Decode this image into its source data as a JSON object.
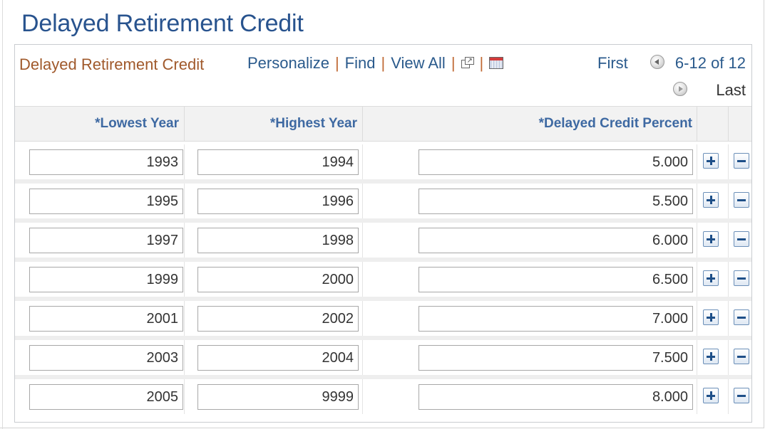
{
  "page": {
    "title": "Delayed Retirement Credit"
  },
  "grid": {
    "title": "Delayed Retirement Credit",
    "toolbar": {
      "personalize": "Personalize",
      "find": "Find",
      "view_all": "View All",
      "separator": "|",
      "zoom_icon": "new-window-icon",
      "download_icon": "spreadsheet-download-icon"
    },
    "pager": {
      "first": "First",
      "range": "6-12 of 12",
      "last": "Last",
      "prev_icon": "previous-arrow-icon",
      "next_icon": "next-arrow-icon"
    },
    "columns": {
      "lowest_year": "*Lowest Year",
      "highest_year": "*Highest Year",
      "credit_percent": "*Delayed Credit Percent"
    },
    "rows": [
      {
        "lowest": "1993",
        "highest": "1994",
        "percent": "5.000"
      },
      {
        "lowest": "1995",
        "highest": "1996",
        "percent": "5.500"
      },
      {
        "lowest": "1997",
        "highest": "1998",
        "percent": "6.000"
      },
      {
        "lowest": "1999",
        "highest": "2000",
        "percent": "6.500"
      },
      {
        "lowest": "2001",
        "highest": "2002",
        "percent": "7.000"
      },
      {
        "lowest": "2003",
        "highest": "2004",
        "percent": "7.500"
      },
      {
        "lowest": "2005",
        "highest": "9999",
        "percent": "8.000"
      }
    ],
    "row_actions": {
      "add_icon": "plus-icon",
      "delete_icon": "minus-icon"
    }
  },
  "colors": {
    "title": "#28538e",
    "grid_title": "#a0592b",
    "link": "#2a5a8c",
    "header_text": "#3e69a2"
  }
}
